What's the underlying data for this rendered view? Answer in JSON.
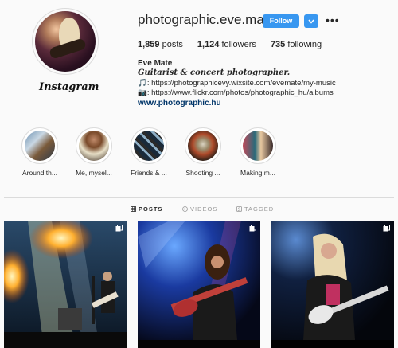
{
  "profile": {
    "username": "photographic.eve.mate",
    "logo_text": "Instagram",
    "follow_label": "Follow",
    "stats": [
      {
        "count": "1,859",
        "label": "posts"
      },
      {
        "count": "1,124",
        "label": "followers"
      },
      {
        "count": "735",
        "label": "following"
      }
    ],
    "bio": {
      "name": "Eve Mate",
      "tagline": "Guitarist & concert photographer.",
      "line1": "🎵: https://photographicevy.wixsite.com/evemate/my-music",
      "line2": "📷: https://www.flickr.com/photos/photographic_hu/albums",
      "website": "www.photographic.hu"
    }
  },
  "highlights": [
    {
      "label": "Around th..."
    },
    {
      "label": "Me, mysel..."
    },
    {
      "label": "Friends & ..."
    },
    {
      "label": "Shooting ..."
    },
    {
      "label": "Making m..."
    }
  ],
  "tabs": [
    {
      "label": "POSTS",
      "icon": "grid-icon",
      "active": true
    },
    {
      "label": "VIDEOS",
      "icon": "video-icon",
      "active": false
    },
    {
      "label": "TAGGED",
      "icon": "tag-icon",
      "active": false
    }
  ],
  "colors": {
    "accent": "#3897f0",
    "link": "#003569",
    "border": "#dbdbdb",
    "background": "#fafafa"
  }
}
